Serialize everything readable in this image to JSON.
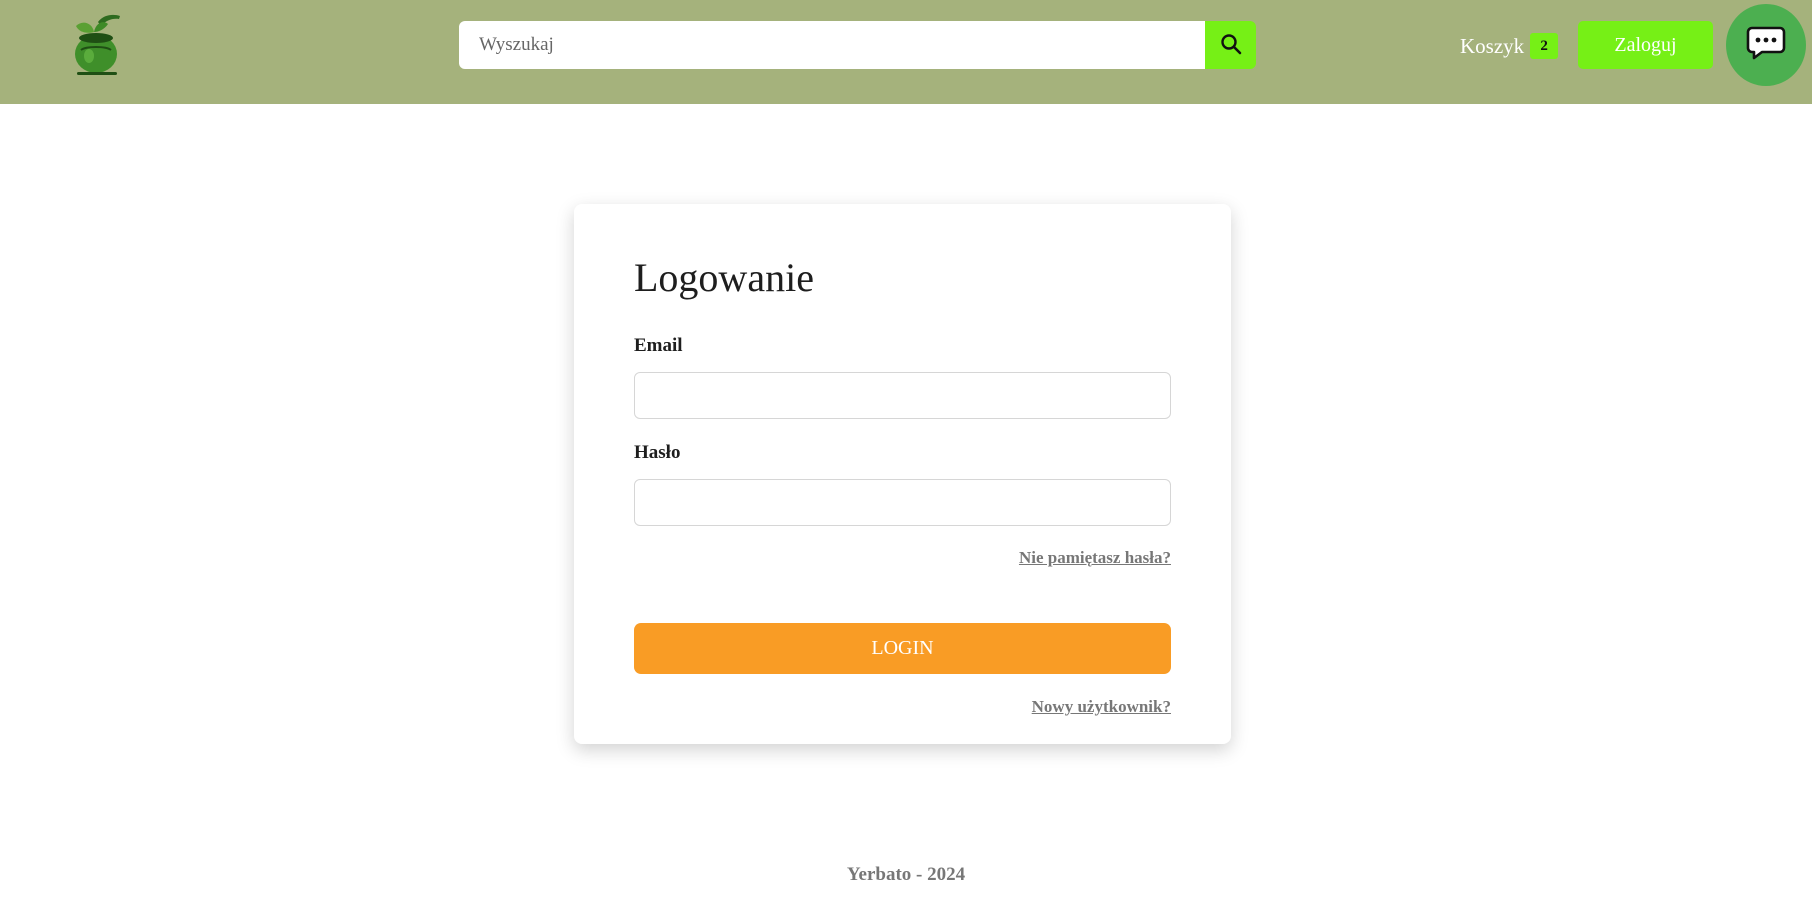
{
  "header": {
    "search": {
      "placeholder": "Wyszukaj",
      "value": ""
    },
    "cart": {
      "label": "Koszyk",
      "count": "2"
    },
    "login_label": "Zaloguj",
    "chat_icon": "chat-bubble-icon",
    "search_icon": "search-icon",
    "logo_icon": "mate-cup-logo-icon"
  },
  "login_form": {
    "title": "Logowanie",
    "email_label": "Email",
    "email_value": "",
    "password_label": "Hasło",
    "password_value": "",
    "forgot_link": "Nie pamiętasz hasła?",
    "submit_label": "LOGIN",
    "register_link": "Nowy użytkownik?"
  },
  "footer": {
    "text": "Yerbato - 2024"
  },
  "colors": {
    "header_bg": "#a5b27c",
    "accent_green": "#76f016",
    "submit_orange": "#f99c25",
    "chat_green": "#4caf50"
  }
}
